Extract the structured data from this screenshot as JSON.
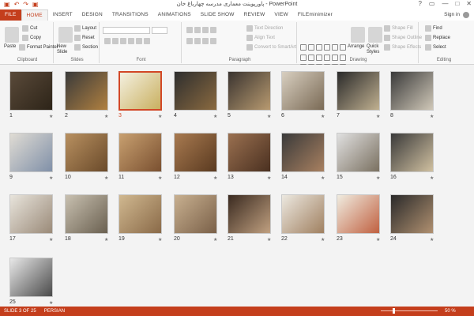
{
  "window": {
    "title": "پاورپوینت معماری مدرسه چهارباغ خان - PowerPoint",
    "controls": [
      "?",
      "▭",
      "—",
      "□",
      "✕"
    ]
  },
  "qat": [
    "▣",
    "↶",
    "↷",
    "▣"
  ],
  "tabs": [
    "FILE",
    "HOME",
    "INSERT",
    "DESIGN",
    "TRANSITIONS",
    "ANIMATIONS",
    "SLIDE SHOW",
    "REVIEW",
    "VIEW",
    "FILEminimizer"
  ],
  "active_tab": "HOME",
  "signin": "Sign in",
  "ribbon": {
    "clipboard": {
      "paste": "Paste",
      "cut": "Cut",
      "copy": "Copy",
      "format_painter": "Format Painter",
      "label": "Clipboard"
    },
    "slides": {
      "new_slide": "New Slide",
      "layout": "Layout",
      "reset": "Reset",
      "section": "Section",
      "label": "Slides"
    },
    "font": {
      "label": "Font"
    },
    "paragraph": {
      "text_direction": "Text Direction",
      "align_text": "Align Text",
      "convert": "Convert to SmartArt",
      "label": "Paragraph"
    },
    "drawing": {
      "arrange": "Arrange",
      "quick_styles": "Quick Styles",
      "shape_fill": "Shape Fill",
      "shape_outline": "Shape Outline",
      "shape_effects": "Shape Effects",
      "label": "Drawing"
    },
    "editing": {
      "find": "Find",
      "replace": "Replace",
      "select": "Select",
      "label": "Editing"
    }
  },
  "slides": [
    {
      "n": "1",
      "bg": "#5a4a3a",
      "accent": "#2d2418"
    },
    {
      "n": "2",
      "bg": "#3a3a3a",
      "accent": "#b08040"
    },
    {
      "n": "3",
      "bg": "#f4f0e0",
      "accent": "#c9b060"
    },
    {
      "n": "4",
      "bg": "#2e2e2e",
      "accent": "#8a6a40"
    },
    {
      "n": "5",
      "bg": "#3a3430",
      "accent": "#b89a70"
    },
    {
      "n": "6",
      "bg": "#d8cfc0",
      "accent": "#7a6a55"
    },
    {
      "n": "7",
      "bg": "#2a2a2a",
      "accent": "#c0b090"
    },
    {
      "n": "8",
      "bg": "#3a3a3a",
      "accent": "#d0c8b8"
    },
    {
      "n": "9",
      "bg": "#e0dcd4",
      "accent": "#8090a8"
    },
    {
      "n": "10",
      "bg": "#b89060",
      "accent": "#6a4a2a"
    },
    {
      "n": "11",
      "bg": "#c8a070",
      "accent": "#7a5030"
    },
    {
      "n": "12",
      "bg": "#a87a50",
      "accent": "#5a3a20"
    },
    {
      "n": "13",
      "bg": "#9a7050",
      "accent": "#4a3020"
    },
    {
      "n": "14",
      "bg": "#3a3a3a",
      "accent": "#a88060"
    },
    {
      "n": "15",
      "bg": "#e0e0e0",
      "accent": "#7a7060"
    },
    {
      "n": "16",
      "bg": "#3a3a3a",
      "accent": "#d0c0a0"
    },
    {
      "n": "17",
      "bg": "#e8e4dc",
      "accent": "#9a8a78"
    },
    {
      "n": "18",
      "bg": "#c8c0b0",
      "accent": "#6a6050"
    },
    {
      "n": "19",
      "bg": "#d0b890",
      "accent": "#8a6a48"
    },
    {
      "n": "20",
      "bg": "#c8b090",
      "accent": "#7a6048"
    },
    {
      "n": "21",
      "bg": "#3a2a20",
      "accent": "#c0a080"
    },
    {
      "n": "22",
      "bg": "#ece8e0",
      "accent": "#a08060"
    },
    {
      "n": "23",
      "bg": "#f0ece0",
      "accent": "#c06040"
    },
    {
      "n": "24",
      "bg": "#2a2a2a",
      "accent": "#b09070"
    },
    {
      "n": "25",
      "bg": "#e8e8e8",
      "accent": "#4a4a4a"
    }
  ],
  "selected_slide": "3",
  "status": {
    "slide": "SLIDE 3 OF 25",
    "language": "PERSIAN",
    "zoom": "50 %",
    "zoom_value": 50
  }
}
